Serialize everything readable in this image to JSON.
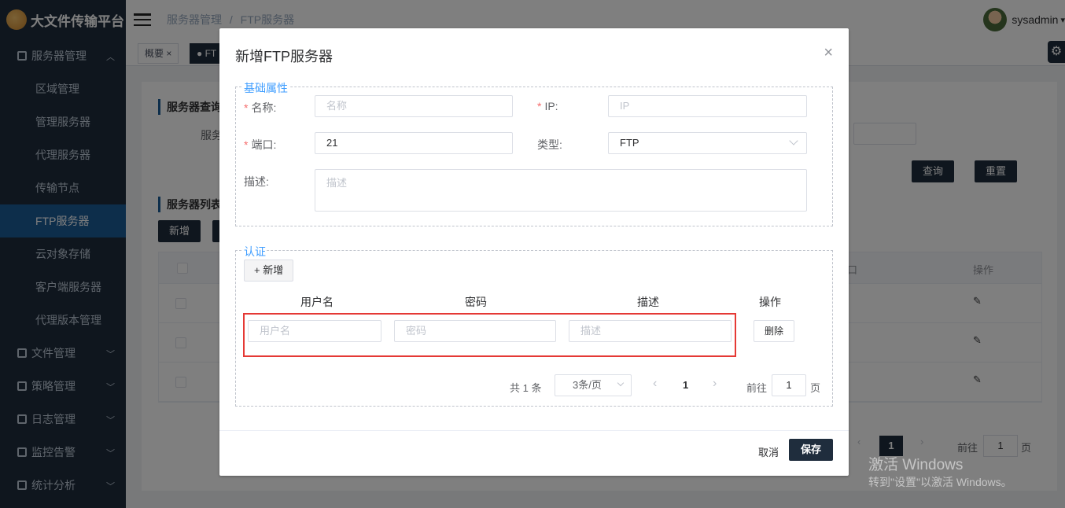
{
  "app": {
    "title": "大文件传输平台"
  },
  "sidebar": {
    "groups": [
      {
        "label": "服务器管理",
        "chevron": "︿"
      },
      {
        "label": "文件管理",
        "chevron": "﹀"
      },
      {
        "label": "策略管理",
        "chevron": "﹀"
      },
      {
        "label": "日志管理",
        "chevron": "﹀"
      },
      {
        "label": "监控告警",
        "chevron": "﹀"
      },
      {
        "label": "统计分析",
        "chevron": "﹀"
      }
    ],
    "items": [
      "区域管理",
      "管理服务器",
      "代理服务器",
      "传输节点",
      "FTP服务器",
      "云对象存储",
      "客户端服务器",
      "代理版本管理"
    ]
  },
  "header": {
    "breadcrumb": [
      "服务器管理",
      "/",
      "FTP服务器"
    ],
    "user": "sysadmin",
    "user_caret": "▾"
  },
  "tags": {
    "overview": "概要 ×",
    "current": "● FT"
  },
  "background": {
    "query_title": "服务器查询",
    "query_label": "服务",
    "query_btn": "查询",
    "reset_btn": "重置",
    "list_title": "服务器列表",
    "add_btn": "新增",
    "col_port": "口",
    "col_ops": "操作",
    "pager_page": "1",
    "goto_label": "前往",
    "goto_value": "1",
    "page_unit": "页"
  },
  "dialog": {
    "title": "新增FTP服务器",
    "close": "×",
    "basic_legend": "基础属性",
    "name_label": "名称:",
    "name_placeholder": "名称",
    "ip_label": "IP:",
    "ip_placeholder": "IP",
    "port_label": "端口:",
    "port_value": "21",
    "type_label": "类型:",
    "type_value": "FTP",
    "desc_label": "描述:",
    "desc_placeholder": "描述",
    "required_mark": "*",
    "auth_legend": "认证",
    "add_btn": "+ 新增",
    "col_username": "用户名",
    "col_password": "密码",
    "col_desc": "描述",
    "col_ops": "操作",
    "row_username_ph": "用户名",
    "row_password_ph": "密码",
    "row_desc_ph": "描述",
    "delete_btn": "删除",
    "pager_total": "共 1 条",
    "pager_size": "3条/页",
    "pager_prev": "‹",
    "pager_page": "1",
    "pager_next": "›",
    "goto_label": "前往",
    "goto_value": "1",
    "page_unit": "页",
    "cancel_btn": "取消",
    "save_btn": "保存"
  },
  "watermark": {
    "line1": "激活 Windows",
    "line2": "转到\"设置\"以激活 Windows。"
  }
}
